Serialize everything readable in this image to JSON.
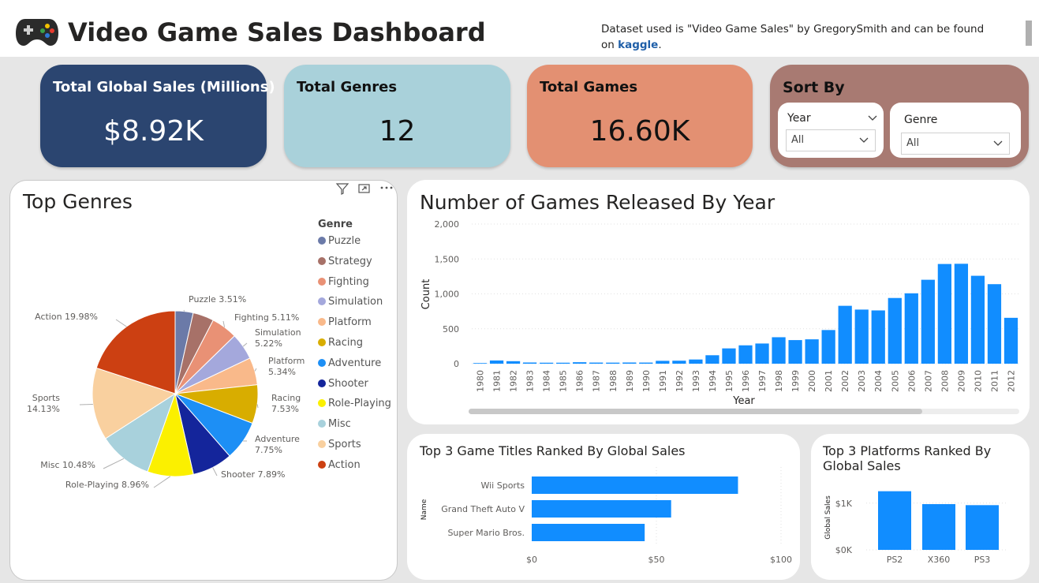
{
  "header": {
    "title": "Video Game Sales Dashboard",
    "note_text": "Dataset used is \"Video Game Sales\" by GregorySmith and can be found on",
    "note_link": "kaggle",
    "note_end": "."
  },
  "cards": {
    "sales": {
      "label": "Total Global Sales (Millions)",
      "value": "$8.92K"
    },
    "genres": {
      "label": "Total Genres",
      "value": "12"
    },
    "games": {
      "label": "Total Games",
      "value": "16.60K"
    }
  },
  "sort": {
    "label": "Sort By",
    "year": {
      "title": "Year",
      "value": "All"
    },
    "genre": {
      "title": "Genre",
      "value": "All"
    }
  },
  "colors": {
    "bar": "#118dff",
    "sales_card": "#2b4570",
    "genres_card": "#a9d1da",
    "games_card": "#e39072",
    "sort_card": "#a87a72"
  },
  "pie": {
    "title": "Top Genres",
    "legend_title": "Genre",
    "chart_data": {
      "type": "pie",
      "slices": [
        {
          "name": "Puzzle",
          "pct": 3.51,
          "label": "Puzzle 3.51%",
          "color": "#6b7aa8"
        },
        {
          "name": "Strategy",
          "pct": 4.1,
          "label": "",
          "color": "#a77168"
        },
        {
          "name": "Fighting",
          "pct": 5.11,
          "label": "Fighting 5.11%",
          "color": "#e99175"
        },
        {
          "name": "Simulation",
          "pct": 5.22,
          "label": "Simulation 5.22%",
          "color": "#a4a8dc"
        },
        {
          "name": "Platform",
          "pct": 5.34,
          "label": "Platform 5.34%",
          "color": "#f9b98a"
        },
        {
          "name": "Racing",
          "pct": 7.53,
          "label": "Racing 7.53%",
          "color": "#d8ad00"
        },
        {
          "name": "Adventure",
          "pct": 7.75,
          "label": "Adventure 7.75%",
          "color": "#1d8ff5"
        },
        {
          "name": "Shooter",
          "pct": 7.89,
          "label": "Shooter 7.89%",
          "color": "#14259b"
        },
        {
          "name": "Role-Playing",
          "pct": 8.96,
          "label": "Role-Playing 8.96%",
          "color": "#fbf000"
        },
        {
          "name": "Misc",
          "pct": 10.48,
          "label": "Misc 10.48%",
          "color": "#a8d1dc"
        },
        {
          "name": "Sports",
          "pct": 14.13,
          "label": "Sports 14.13%",
          "color": "#f9d09f"
        },
        {
          "name": "Action",
          "pct": 19.98,
          "label": "Action 19.98%",
          "color": "#cc4012"
        }
      ]
    }
  },
  "year_chart": {
    "title": "Number of Games Released By Year",
    "chart_data": {
      "type": "bar",
      "xlabel": "Year",
      "ylabel": "Count",
      "ylim": [
        0,
        2000
      ],
      "yticks": [
        "0",
        "500",
        "1,000",
        "1,500",
        "2,000"
      ],
      "categories": [
        "1980",
        "1981",
        "1982",
        "1983",
        "1984",
        "1985",
        "1986",
        "1987",
        "1988",
        "1989",
        "1990",
        "1991",
        "1992",
        "1993",
        "1994",
        "1995",
        "1996",
        "1997",
        "1998",
        "1999",
        "2000",
        "2001",
        "2002",
        "2003",
        "2004",
        "2005",
        "2006",
        "2007",
        "2008",
        "2009",
        "2010",
        "2011",
        "2012"
      ],
      "values": [
        9,
        46,
        36,
        17,
        14,
        14,
        21,
        16,
        15,
        17,
        16,
        41,
        43,
        60,
        121,
        219,
        263,
        289,
        379,
        338,
        349,
        482,
        829,
        775,
        763,
        941,
        1008,
        1202,
        1428,
        1431,
        1259,
        1139,
        657
      ]
    }
  },
  "titles_chart": {
    "title": "Top 3 Game Titles Ranked By Global Sales",
    "chart_data": {
      "type": "bar",
      "orientation": "horizontal",
      "ylabel": "Name",
      "categories": [
        "Wii Sports",
        "Grand Theft Auto V",
        "Super Mario Bros."
      ],
      "values": [
        82.74,
        55.92,
        45.31
      ],
      "xlim": [
        0,
        100
      ],
      "xticks": [
        "$0",
        "$50",
        "$100"
      ]
    }
  },
  "platforms_chart": {
    "title_line1": "Top 3 Platforms Ranked By",
    "title_line2": "Global Sales",
    "chart_data": {
      "type": "bar",
      "ylabel": "Global Sales",
      "categories": [
        "PS2",
        "X360",
        "PS3"
      ],
      "values": [
        1255,
        979,
        957
      ],
      "ylim": [
        0,
        1300
      ],
      "yticks": [
        "$0K",
        "$1K"
      ]
    }
  }
}
